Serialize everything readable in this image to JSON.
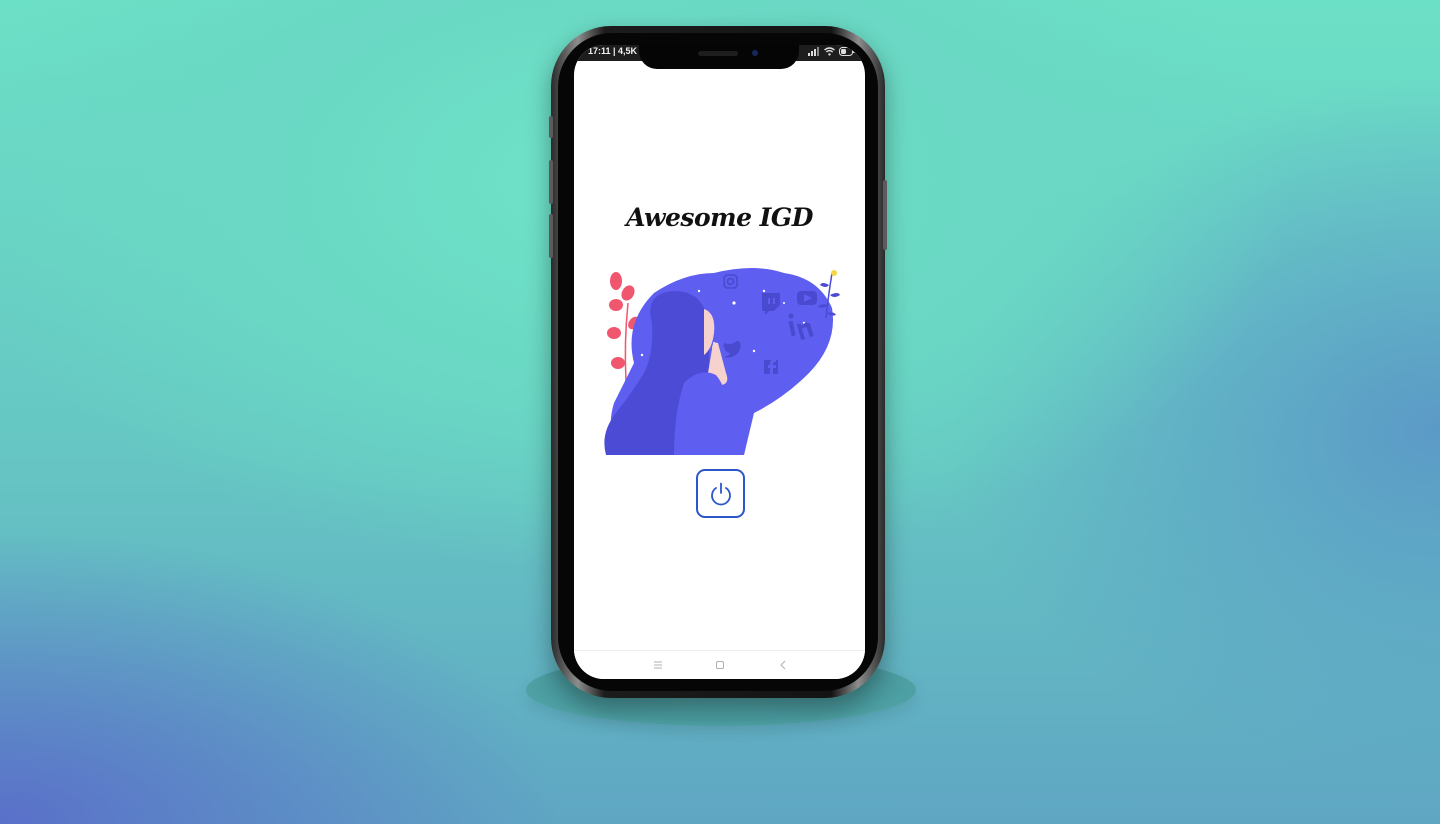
{
  "status_bar": {
    "time": "17:11 | 4,5K"
  },
  "app": {
    "title": "Awesome IGD"
  },
  "illustration": {
    "social_icons": [
      "instagram-icon",
      "twitch-icon",
      "youtube-icon",
      "linkedin-icon",
      "twitter-icon",
      "facebook-icon"
    ]
  },
  "power_button": {
    "icon": "power-icon",
    "color": "#2b57c9"
  },
  "navigation": {
    "items": [
      "menu-icon",
      "home-square-icon",
      "back-chevron-icon"
    ]
  },
  "colors": {
    "blob": "#5e5ef0",
    "hair": "#4b4bd6",
    "leaves": "#f0566e",
    "accent": "#2b57c9"
  }
}
